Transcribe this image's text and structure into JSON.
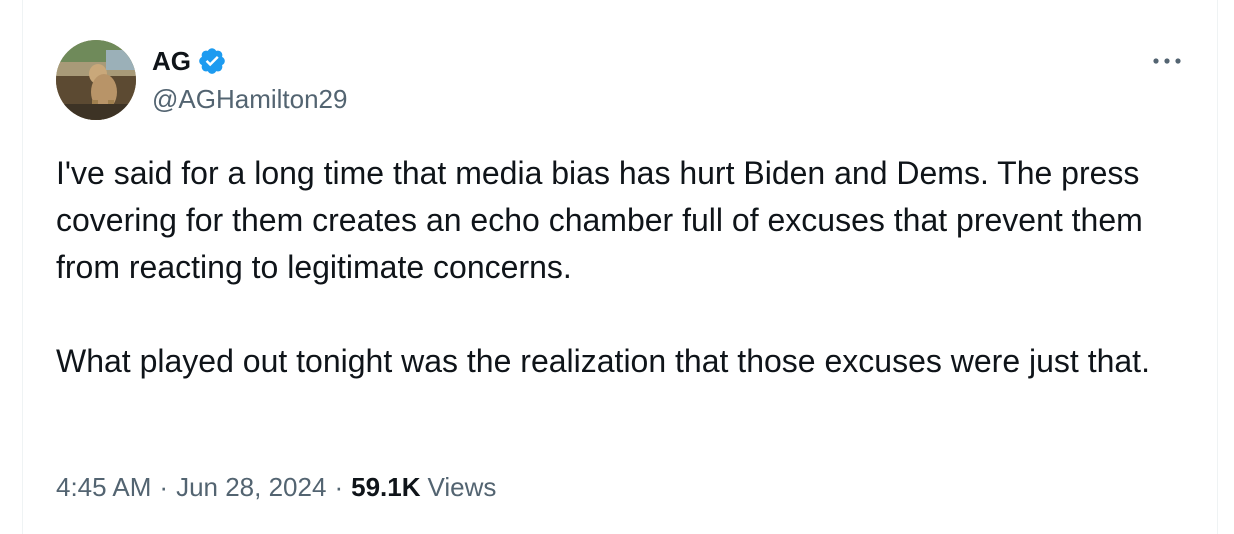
{
  "author": {
    "display_name": "AG",
    "handle": "@AGHamilton29",
    "verified": true,
    "verified_color": "#1d9bf0"
  },
  "tweet": {
    "paragraphs": [
      "I've said for a long time that media bias has hurt Biden and Dems. The press covering for them creates an echo chamber full of excuses that prevent them from reacting to legitimate concerns.",
      "What played out tonight was the realization that those excuses were just that."
    ],
    "time": "4:45 AM",
    "separator": "·",
    "date": "Jun 28, 2024",
    "views_count": "59.1K",
    "views_label": "Views"
  },
  "icons": {
    "avatar": "profile-photo",
    "verified": "verified-badge-icon",
    "more": "more-dots-icon"
  },
  "colors": {
    "text_primary": "#0f1419",
    "text_secondary": "#536471",
    "border": "#eff3f4"
  }
}
